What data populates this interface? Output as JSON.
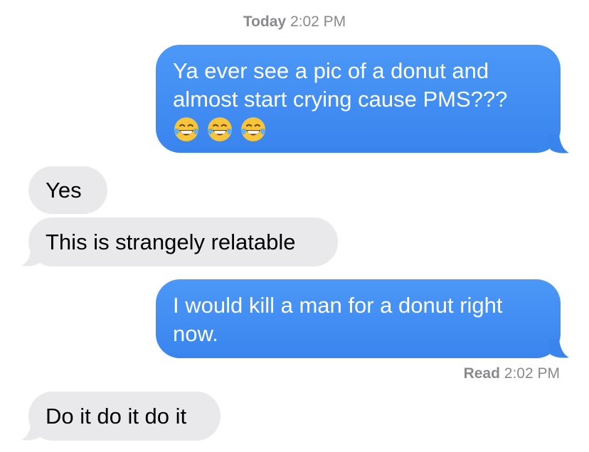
{
  "conversation": {
    "header_timestamp": {
      "day": "Today",
      "time": "2:02 PM"
    },
    "messages": [
      {
        "id": "m1",
        "direction": "outgoing",
        "text_lines": [
          "Ya ever see a pic of a donut and",
          "almost start crying cause PMS???"
        ],
        "emoji": [
          "tears-of-joy-emoji",
          "tears-of-joy-emoji",
          "tears-of-joy-emoji"
        ]
      },
      {
        "id": "m2",
        "direction": "incoming",
        "text": "Yes"
      },
      {
        "id": "m3",
        "direction": "incoming",
        "text": "This is strangely relatable"
      },
      {
        "id": "m4",
        "direction": "outgoing",
        "text_lines": [
          "I would kill a man for a donut right",
          "now."
        ]
      },
      {
        "id": "m5",
        "direction": "incoming",
        "text": "Do it do it do it"
      }
    ],
    "read_receipt": {
      "label": "Read",
      "time": "2:02 PM"
    }
  },
  "colors": {
    "outgoing_bubble": "#4b98f7",
    "incoming_bubble": "#e9e9eb",
    "timestamp_text": "#8a8a8e"
  }
}
